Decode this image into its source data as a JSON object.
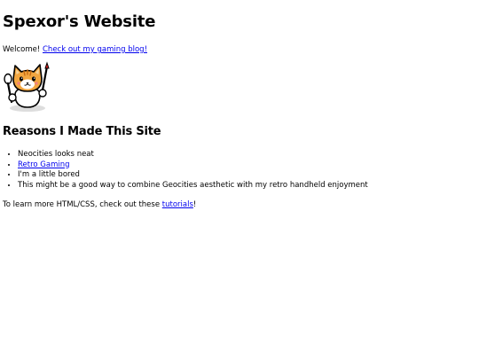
{
  "header": {
    "title": "Spexor's Website"
  },
  "intro": {
    "text": "Welcome! ",
    "link_label": "Check out my gaming blog!"
  },
  "mascot": {
    "icon": "cat-mascot-icon"
  },
  "reasons": {
    "heading": "Reasons I Made This Site",
    "items": [
      {
        "label": "Neocities looks neat"
      },
      {
        "label": "Retro Gaming"
      },
      {
        "label": "I'm a little bored"
      },
      {
        "label": "This might be a good way to combine Geocities aesthetic with my retro handheld enjoyment"
      }
    ]
  },
  "outro": {
    "text_before": "To learn more HTML/CSS, check out these ",
    "link_label": "tutorials",
    "text_after": "!"
  },
  "colors": {
    "link": "#0000ee",
    "text": "#000000",
    "background": "#ffffff"
  }
}
